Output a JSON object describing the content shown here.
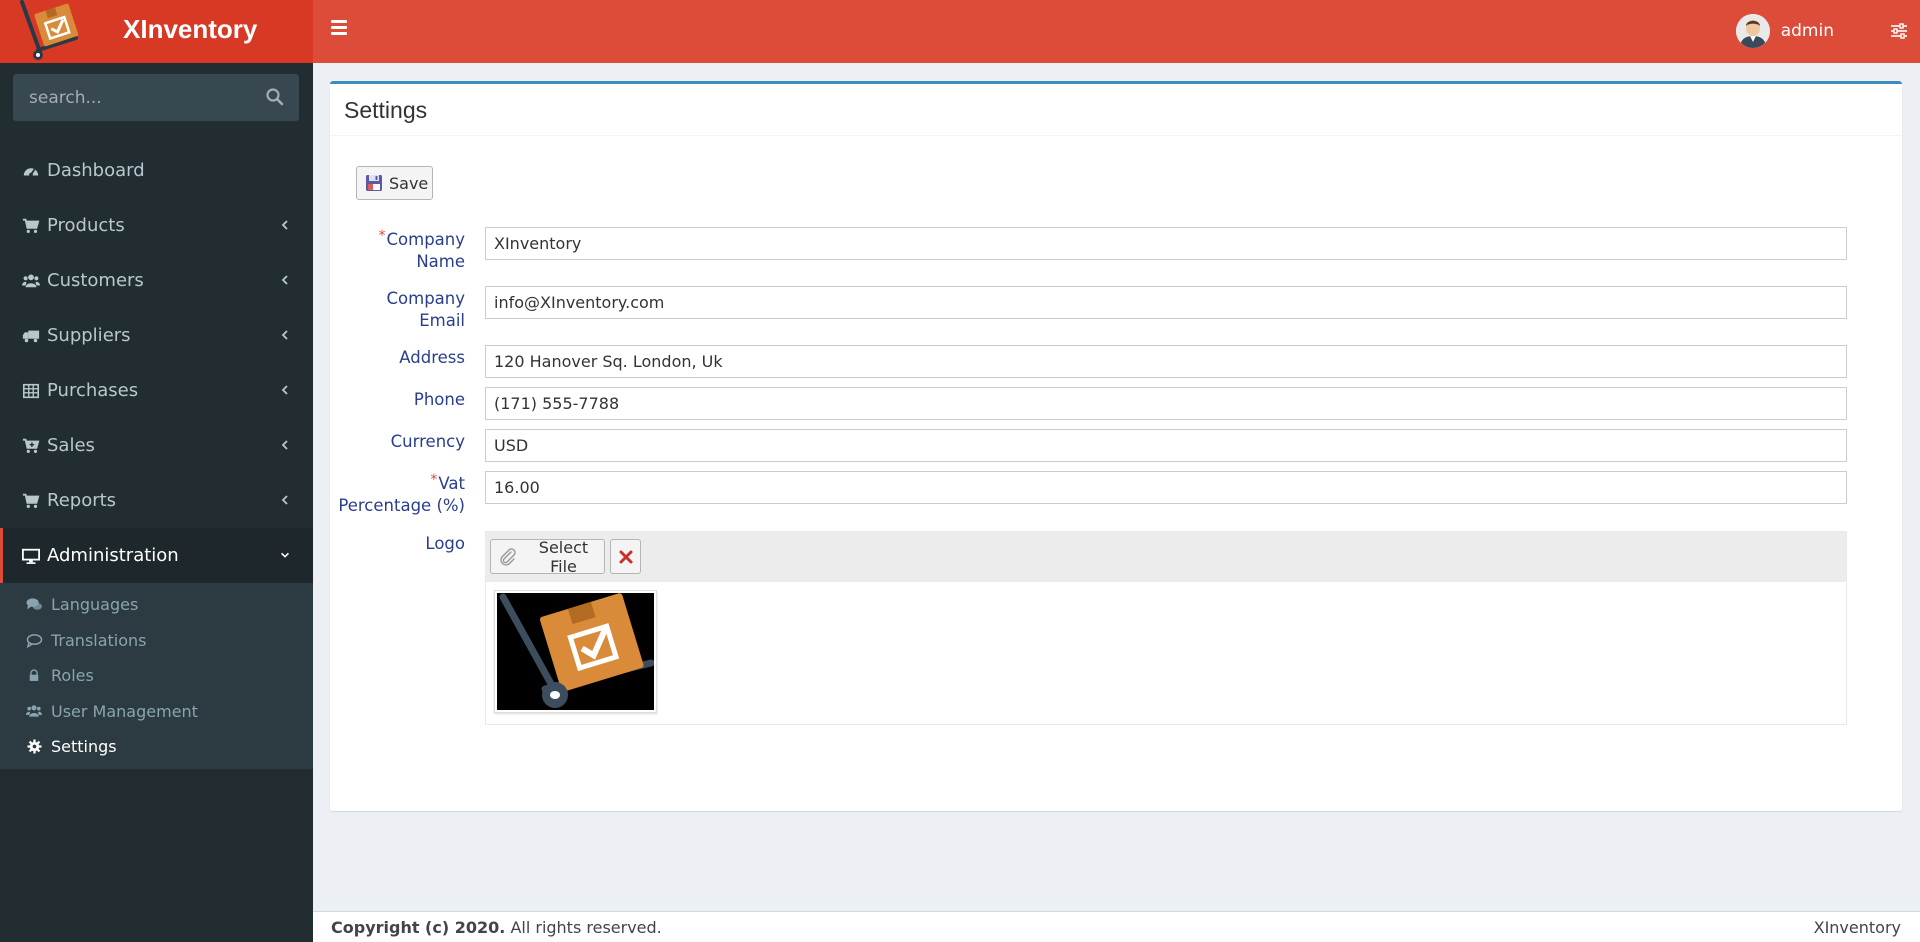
{
  "brand": {
    "name": "XInventory"
  },
  "header": {
    "user_name": "admin"
  },
  "sidebar": {
    "search_placeholder": "search...",
    "items": [
      {
        "label": "Dashboard",
        "icon": "dashboard-icon"
      },
      {
        "label": "Products",
        "icon": "cart-icon"
      },
      {
        "label": "Customers",
        "icon": "users-icon"
      },
      {
        "label": "Suppliers",
        "icon": "truck-icon"
      },
      {
        "label": "Purchases",
        "icon": "table-icon"
      },
      {
        "label": "Sales",
        "icon": "cart-plus-icon"
      },
      {
        "label": "Reports",
        "icon": "cart-icon"
      },
      {
        "label": "Administration",
        "icon": "desktop-icon"
      }
    ],
    "admin_subitems": [
      {
        "label": "Languages",
        "icon": "comments-icon"
      },
      {
        "label": "Translations",
        "icon": "comment-icon"
      },
      {
        "label": "Roles",
        "icon": "lock-icon"
      },
      {
        "label": "User Management",
        "icon": "users-icon"
      },
      {
        "label": "Settings",
        "icon": "gear-icon"
      }
    ]
  },
  "page": {
    "title": "Settings",
    "save_label": "Save",
    "fields": [
      {
        "label_line1": "Company",
        "label_line2": "Name",
        "required": true,
        "value": "XInventory"
      },
      {
        "label_line1": "Company",
        "label_line2": "Email",
        "required": false,
        "value": "info@XInventory.com"
      },
      {
        "label": "Address",
        "value": "120 Hanover Sq. London, Uk"
      },
      {
        "label": "Phone",
        "value": "(171) 555-7788"
      },
      {
        "label": "Currency",
        "value": "USD"
      },
      {
        "label_line1": "Vat",
        "label_line2": "Percentage (%)",
        "required": true,
        "value": "16.00"
      }
    ],
    "logo": {
      "label": "Logo",
      "select_file_label": "Select File"
    }
  },
  "footer": {
    "copyright": "Copyright (c) 2020.",
    "rights": "All rights reserved.",
    "app_name": "XInventory"
  },
  "colors": {
    "brand_bg": "#d73925",
    "topbar_bg": "#dd4b39",
    "sidebar_bg": "#222d32",
    "box_accent": "#3c8dbc"
  }
}
